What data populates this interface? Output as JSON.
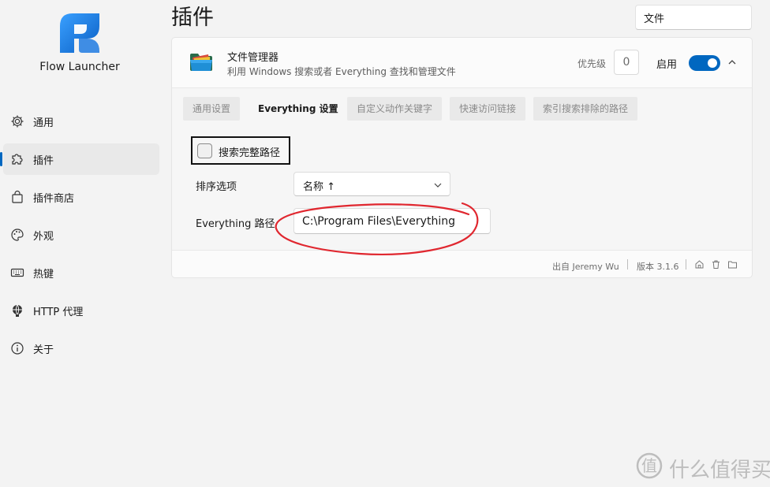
{
  "app": {
    "name": "Flow Launcher"
  },
  "sidebar": {
    "items": [
      {
        "label": "通用",
        "icon": "gear-icon",
        "active": false
      },
      {
        "label": "插件",
        "icon": "puzzle-icon",
        "active": true
      },
      {
        "label": "插件商店",
        "icon": "store-bag-icon",
        "active": false
      },
      {
        "label": "外观",
        "icon": "palette-icon",
        "active": false
      },
      {
        "label": "热键",
        "icon": "keyboard-icon",
        "active": false
      },
      {
        "label": "HTTP 代理",
        "icon": "globe-network-icon",
        "active": false
      },
      {
        "label": "关于",
        "icon": "info-icon",
        "active": false
      }
    ]
  },
  "header": {
    "title": "插件",
    "search_value": "文件"
  },
  "plugin": {
    "name": "文件管理器",
    "description": "利用 Windows 搜索或者 Everything 查找和管理文件",
    "priority_label": "优先级",
    "priority_value": "0",
    "enabled_label": "启用",
    "enabled": true,
    "tabs": [
      "通用设置",
      "Everything 设置",
      "自定义动作关键字",
      "快速访问链接",
      "索引搜索排除的路径"
    ],
    "active_tab": "Everything 设置",
    "settings": {
      "full_path_label": "搜索完整路径",
      "full_path_checked": false,
      "sort_label": "排序选项",
      "sort_value": "名称 ↑",
      "path_label": "Everything 路径",
      "path_value": "C:\\Program Files\\Everything"
    },
    "footer": {
      "author": "出自 Jeremy Wu",
      "version": "版本 3.1.6"
    }
  },
  "watermark": {
    "text": "什么值得买"
  },
  "colors": {
    "accent": "#0067c0",
    "annotation": "#e0272f"
  }
}
